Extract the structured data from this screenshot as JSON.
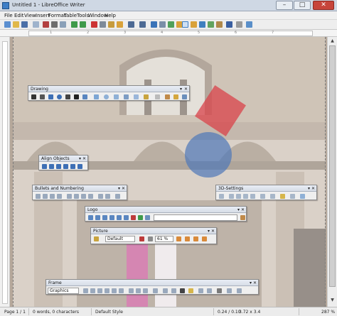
{
  "window": {
    "title": "Untitled 1 - LibreOffice Writer",
    "minimize_label": "–",
    "maximize_label": "□",
    "close_label": "✕"
  },
  "menu": [
    "File",
    "Edit",
    "View",
    "Insert",
    "Format",
    "Table",
    "Tools",
    "Window",
    "Help"
  ],
  "ruler": {
    "ticks": [
      "1",
      "2",
      "3",
      "4",
      "5",
      "6",
      "7"
    ]
  },
  "status": {
    "page": "Page 1 / 1",
    "words": "0 words, 0 characters",
    "style": "Default Style",
    "position": "0.24 / 0.10",
    "size": "3.72 x 3.4",
    "zoom": "287 %"
  },
  "toolbars": {
    "drawing": {
      "title": "Drawing"
    },
    "align": {
      "title": "Align Objects"
    },
    "bullets": {
      "title": "Bullets and Numbering"
    },
    "settings3d": {
      "title": "3D-Settings"
    },
    "logo": {
      "title": "Logo",
      "field_value": ""
    },
    "picture": {
      "title": "Picture",
      "mode_value": "Default",
      "transparency_value": "61 %"
    },
    "frame": {
      "title": "Frame",
      "type_value": "Graphics"
    }
  },
  "shapes": {
    "square_color": "#d9434a",
    "circle_color": "#4f78b8"
  },
  "colors": {
    "accent": "#3d7ec6",
    "close": "#c7453b"
  }
}
